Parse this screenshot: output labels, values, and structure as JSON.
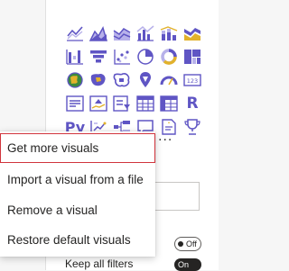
{
  "visuals_grid": {
    "icons": [
      "line-chart-icon",
      "area-chart-icon",
      "stacked-area-chart-icon",
      "line-clustered-column-icon",
      "line-stacked-column-icon",
      "ribbon-chart-icon",
      "waterfall-chart-icon",
      "funnel-chart-icon",
      "scatter-chart-icon",
      "pie-chart-icon",
      "donut-chart-icon",
      "treemap-icon",
      "map-icon",
      "filled-map-icon",
      "shape-map-icon",
      "azure-map-icon",
      "gauge-icon",
      "card-icon",
      "multi-row-card-icon",
      "kpi-icon",
      "slicer-icon",
      "table-icon",
      "matrix-icon",
      "r-visual-icon",
      "python-visual-icon",
      "key-influencers-icon",
      "decomposition-tree-icon",
      "qa-icon",
      "smart-narrative-icon",
      "goals-icon"
    ],
    "r_label": "R",
    "py_label": "Py",
    "more_label": "···"
  },
  "menu": {
    "items": [
      {
        "label": "Get more visuals"
      },
      {
        "label": "Import a visual from a file"
      },
      {
        "label": "Remove a visual"
      },
      {
        "label": "Restore default visuals"
      }
    ]
  },
  "format": {
    "toggle_off_label": "Off",
    "keep_all_filters_label": "Keep all filters",
    "toggle_on_label": "On"
  },
  "colors": {
    "accent": "#5f55c4",
    "accent_light": "#b7b1ea",
    "gold": "#e2b22b",
    "selection_border": "#d1343c"
  }
}
